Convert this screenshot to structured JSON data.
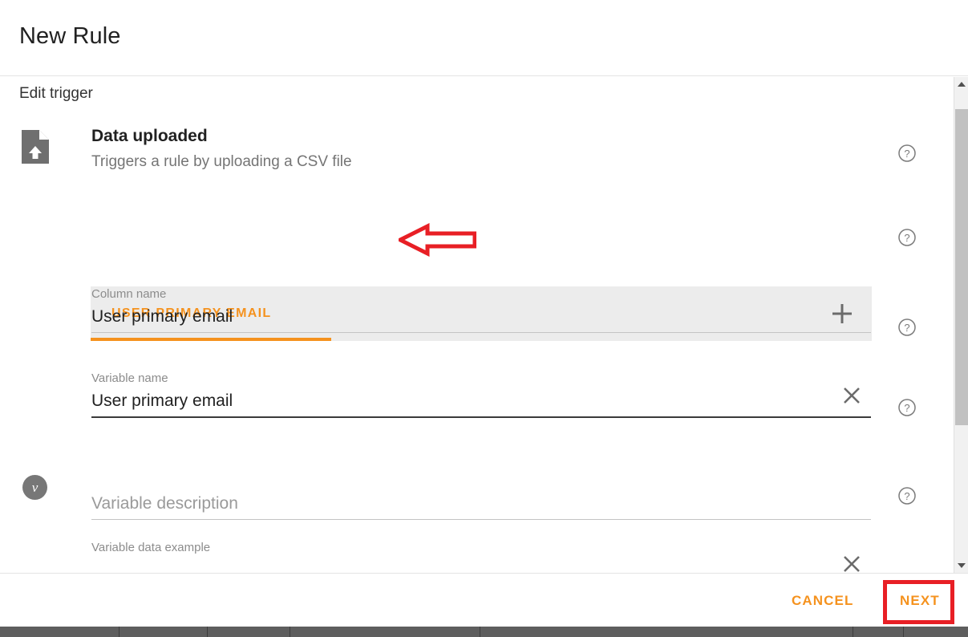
{
  "window": {
    "title": "New Rule"
  },
  "section": {
    "title": "Edit trigger"
  },
  "trigger": {
    "icon": "file-upload-icon",
    "name": "Data uploaded",
    "description": "Triggers a rule by uploading a CSV file"
  },
  "annotations": {
    "arrow": {
      "name": "red-left-arrow-annotation",
      "color": "#e81f25",
      "points_to": "Triggers a rule by uploading a CSV file"
    },
    "next_box": {
      "name": "red-highlight-box-annotation",
      "color": "#e81f25",
      "highlights": "NEXT"
    }
  },
  "tabs": {
    "accent_color": "#F5921E",
    "background": "#ececec",
    "items": [
      {
        "label": "USER PRIMARY EMAIL",
        "selected": true
      }
    ],
    "add_icon": "plus-icon"
  },
  "variable_badge": {
    "glyph": "v",
    "color": "#777777"
  },
  "fields": [
    {
      "key": "column_name",
      "label": "Column name",
      "value": "User primary email",
      "placeholder": "",
      "focused": false,
      "clearable": false
    },
    {
      "key": "variable_name",
      "label": "Variable name",
      "value": "User primary email",
      "placeholder": "",
      "focused": true,
      "clearable": true,
      "clear_icon": "close-icon"
    },
    {
      "key": "variable_description",
      "label": "",
      "value": "",
      "placeholder": "Variable description",
      "focused": false,
      "clearable": false
    },
    {
      "key": "variable_data_example",
      "label": "Variable data example",
      "value": "",
      "placeholder": "",
      "focused": false,
      "clearable": true,
      "clear_icon": "close-icon"
    }
  ],
  "help_icon": "help-circle-icon",
  "scrollbar": {
    "up_icon": "caret-up-icon",
    "down_icon": "caret-down-icon",
    "thumb": "scroll-thumb"
  },
  "footer": {
    "cancel_label": "CANCEL",
    "next_label": "NEXT",
    "accent_color": "#F5921E"
  }
}
